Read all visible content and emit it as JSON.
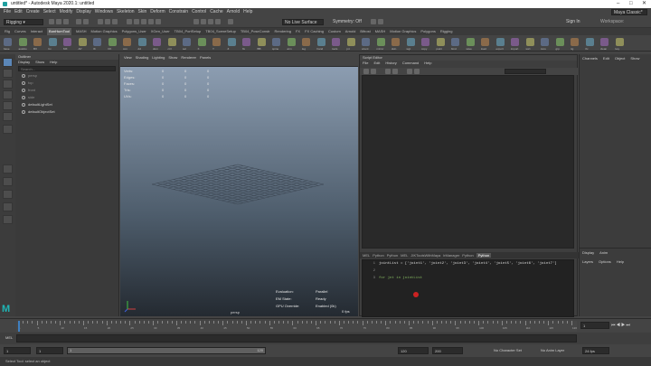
{
  "window": {
    "title": "untitled* - Autodesk Maya 2020.1: untitled"
  },
  "menubar": {
    "items": [
      "File",
      "Edit",
      "Create",
      "Select",
      "Modify",
      "Display",
      "Windows",
      "Skeleton",
      "Skin",
      "Deform",
      "Constrain",
      "Control",
      "Cache",
      "Arnold",
      "Help"
    ]
  },
  "status_line": {
    "mode": "Rigging",
    "live_surface": "No Live Surface",
    "symmetry": "Symmetry: Off",
    "workspace_label": "Workspace:",
    "workspace": "Maya Classic*",
    "sign_in": "Sign In"
  },
  "shelf": {
    "tabs": [
      "Rig",
      "Curves",
      "Interact",
      "BonHumTool",
      "MASH",
      "Motion Graphics",
      "Polygons_User",
      "XGen_User",
      "TB04_PortSetup",
      "TB04_SceneSetup",
      "TB04_PoseConstr",
      "Rendering",
      "FX",
      "FX Caching",
      "Custom",
      "Arnold",
      "Bifrost",
      "MASH",
      "Motion Graphics",
      "Polygons",
      "Rigging"
    ],
    "active_tab": "BonHumTool",
    "icon_labels": [
      "base",
      "autobo",
      "BX",
      "bx",
      "MX",
      "AP",
      "IK",
      "FK",
      "con",
      "dd",
      "dom",
      "ctrl",
      "sel",
      "X",
      "Y",
      "Z",
      "fix",
      "BB",
      "spine",
      "arm",
      "leg",
      "hand",
      "tools",
      "jnt",
      "orient",
      "mirror",
      "skin",
      "wgt",
      "copy",
      "paint",
      "bind",
      "save",
      "load",
      "export",
      "import",
      "sort",
      "zero",
      "grp",
      "rig",
      "fix",
      "clean",
      "key"
    ]
  },
  "outliner": {
    "title": "Outliner",
    "menu": [
      "Display",
      "Show",
      "Help"
    ],
    "search_placeholder": "Search...",
    "items": [
      "persp",
      "top",
      "front",
      "side",
      "defaultLightSet",
      "defaultObjectSet"
    ]
  },
  "viewport": {
    "menu": [
      "View",
      "Shading",
      "Lighting",
      "Show",
      "Renderer",
      "Panels"
    ],
    "stats": [
      {
        "label": "Verts:",
        "a": "0",
        "b": "0",
        "c": "0"
      },
      {
        "label": "Edges:",
        "a": "0",
        "b": "0",
        "c": "0"
      },
      {
        "label": "Faces:",
        "a": "0",
        "b": "0",
        "c": "0"
      },
      {
        "label": "Tris:",
        "a": "0",
        "b": "0",
        "c": "0"
      },
      {
        "label": "UVs:",
        "a": "0",
        "b": "0",
        "c": "0"
      }
    ],
    "evaluation_rows": [
      {
        "label": "Evaluation:",
        "value": "Parallel"
      },
      {
        "label": "EM State:",
        "value": "Ready"
      },
      {
        "label": "GPU Override:",
        "value": "Enabled (0k)"
      }
    ],
    "fps": "0 fps",
    "camera": "persp",
    "axis": {
      "x": "X",
      "y": "Y",
      "z": "Z"
    }
  },
  "script_editor": {
    "title": "Script Editor",
    "menu": [
      "File",
      "Edit",
      "History",
      "Command",
      "Help"
    ],
    "tabs": [
      "MEL",
      "Python",
      "Python",
      "MEL",
      "JIKToolsWithMaya",
      "lrManager",
      "Python",
      "Python"
    ],
    "active_tab_index": 7,
    "lines": [
      {
        "n": "1",
        "text": "jointList = ['joint1', 'joint2', 'joint3', 'joint4', 'joint5', 'joint6', 'joint7']"
      },
      {
        "n": "2",
        "text": ""
      },
      {
        "n": "3",
        "text": "for jnt in jointList"
      }
    ]
  },
  "channel_box": {
    "menu": [
      "Channels",
      "Edit",
      "Object",
      "Show"
    ],
    "tabs": [
      "Display",
      "Anim"
    ],
    "sub_menu": [
      "Layers",
      "Options",
      "Help"
    ]
  },
  "time_slider": {
    "ticks": [
      "1",
      "5",
      "10",
      "15",
      "20",
      "25",
      "30",
      "35",
      "40",
      "45",
      "50",
      "55",
      "60",
      "65",
      "70",
      "75",
      "80",
      "85",
      "90",
      "95",
      "100",
      "105",
      "110",
      "115",
      "120"
    ],
    "current_frame": "1"
  },
  "command_line": {
    "label": "MEL"
  },
  "range_slider": {
    "start": "1",
    "inner_start": "1",
    "inner_start_field": "1",
    "inner_end": "120",
    "end_field": "120",
    "end": "200",
    "character_set": "No Character Set",
    "anim_layer": "No Anim Layer",
    "fps": "24 fps"
  },
  "help_line": {
    "text": "Select Tool: select an object"
  }
}
